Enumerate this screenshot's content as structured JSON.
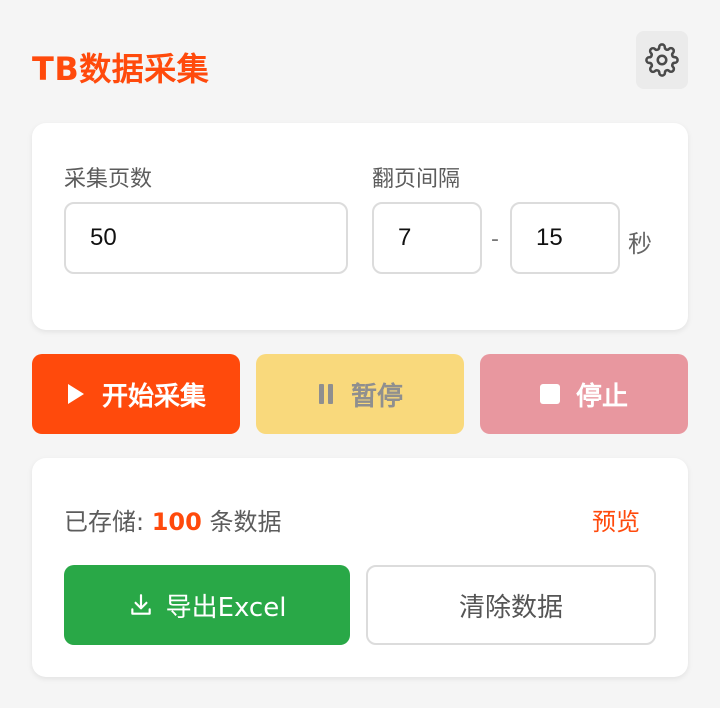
{
  "header": {
    "title": "TB数据采集",
    "settings_icon": "gear-icon"
  },
  "config": {
    "pages_label": "采集页数",
    "pages_value": "50",
    "interval_label": "翻页间隔",
    "interval_min": "7",
    "interval_separator": "-",
    "interval_max": "15",
    "interval_unit": "秒"
  },
  "actions": {
    "start_label": "开始采集",
    "pause_label": "暂停",
    "stop_label": "停止",
    "start_color": "#ff4a0c",
    "pause_color": "#f9d97c",
    "stop_color": "#e8979f"
  },
  "data_panel": {
    "stored_prefix": "已存储:",
    "stored_count": "100",
    "stored_suffix": "条数据",
    "preview_label": "预览",
    "export_label": "导出Excel",
    "clear_label": "清除数据",
    "export_color": "#29a847"
  }
}
